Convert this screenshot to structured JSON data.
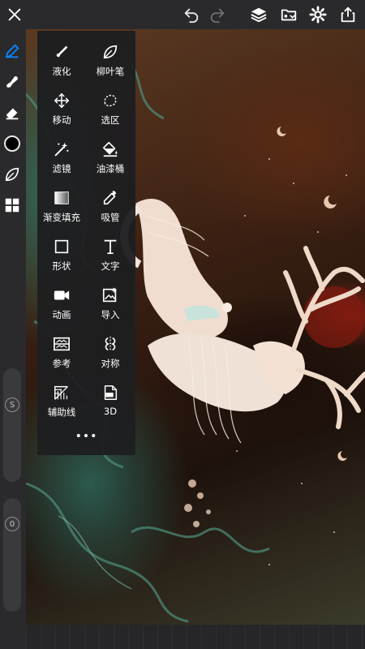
{
  "topbar": {
    "close_icon": "close-icon",
    "undo_icon": "undo-icon",
    "redo_icon": "redo-icon",
    "layers_icon": "layers-icon",
    "gallery_icon": "gallery-import-icon",
    "settings_icon": "gear-icon",
    "share_icon": "share-icon"
  },
  "sidebar": {
    "items": [
      {
        "icon": "pen-icon",
        "active": true
      },
      {
        "icon": "smudge-icon"
      },
      {
        "icon": "eraser-icon"
      },
      {
        "icon": "color-swatch",
        "color": "#000000"
      },
      {
        "icon": "leaf-brush-icon"
      },
      {
        "icon": "grid-apps-icon"
      }
    ],
    "size_slider_label": "S",
    "opacity_slider_label": "0"
  },
  "tools": [
    {
      "label": "液化",
      "icon": "liquify-icon"
    },
    {
      "label": "柳叶笔",
      "icon": "willow-pen-icon"
    },
    {
      "label": "移动",
      "icon": "move-icon"
    },
    {
      "label": "选区",
      "icon": "selection-icon"
    },
    {
      "label": "滤镜",
      "icon": "filter-wand-icon"
    },
    {
      "label": "油漆桶",
      "icon": "paint-bucket-icon"
    },
    {
      "label": "渐变填充",
      "icon": "gradient-fill-icon"
    },
    {
      "label": "吸管",
      "icon": "eyedropper-icon"
    },
    {
      "label": "形状",
      "icon": "shape-icon"
    },
    {
      "label": "文字",
      "icon": "text-icon"
    },
    {
      "label": "动画",
      "icon": "animation-icon"
    },
    {
      "label": "导入",
      "icon": "import-image-icon"
    },
    {
      "label": "参考",
      "icon": "reference-icon"
    },
    {
      "label": "对称",
      "icon": "symmetry-icon"
    },
    {
      "label": "辅助线",
      "icon": "guide-icon"
    },
    {
      "label": "3D",
      "icon": "3d-file-icon"
    }
  ],
  "more_label": "•••",
  "colors": {
    "accent": "#0a84ff",
    "bar_bg": "#2a2a2c",
    "panel_bg": "#1e1e20"
  }
}
